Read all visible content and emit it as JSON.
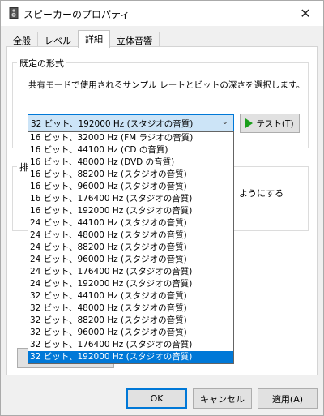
{
  "window": {
    "title": "スピーカーのプロパティ",
    "close_glyph": "✕"
  },
  "tabs": [
    {
      "label": "全般",
      "active": false
    },
    {
      "label": "レベル",
      "active": false
    },
    {
      "label": "詳細",
      "active": true
    },
    {
      "label": "立体音響",
      "active": false
    }
  ],
  "default_format": {
    "group_label": "既定の形式",
    "description": "共有モードで使用されるサンプル レートとビットの深さを選択します。",
    "selected_value": "32 ビット、192000 Hz (スタジオの音質)",
    "test_button_label": "テスト(T)"
  },
  "obscured": {
    "group2_label_fragment": "排",
    "text_fragment": "ようにする"
  },
  "format_options": [
    "16 ビット、32000 Hz (FM ラジオの音質)",
    "16 ビット、44100 Hz (CD の音質)",
    "16 ビット、48000 Hz (DVD の音質)",
    "16 ビット、88200 Hz (スタジオの音質)",
    "16 ビット、96000 Hz (スタジオの音質)",
    "16 ビット、176400 Hz (スタジオの音質)",
    "16 ビット、192000 Hz (スタジオの音質)",
    "24 ビット、44100 Hz (スタジオの音質)",
    "24 ビット、48000 Hz (スタジオの音質)",
    "24 ビット、88200 Hz (スタジオの音質)",
    "24 ビット、96000 Hz (スタジオの音質)",
    "24 ビット、176400 Hz (スタジオの音質)",
    "24 ビット、192000 Hz (スタジオの音質)",
    "32 ビット、44100 Hz (スタジオの音質)",
    "32 ビット、48000 Hz (スタジオの音質)",
    "32 ビット、88200 Hz (スタジオの音質)",
    "32 ビット、96000 Hz (スタジオの音質)",
    "32 ビット、176400 Hz (スタジオの音質)",
    "32 ビット、192000 Hz (スタジオの音質)"
  ],
  "selected_option_index": 18,
  "buttons": {
    "ok": "OK",
    "cancel": "キャンセル",
    "apply": "適用(A)"
  },
  "colors": {
    "accent": "#0078d7",
    "play_icon": "#1a9e1a"
  }
}
